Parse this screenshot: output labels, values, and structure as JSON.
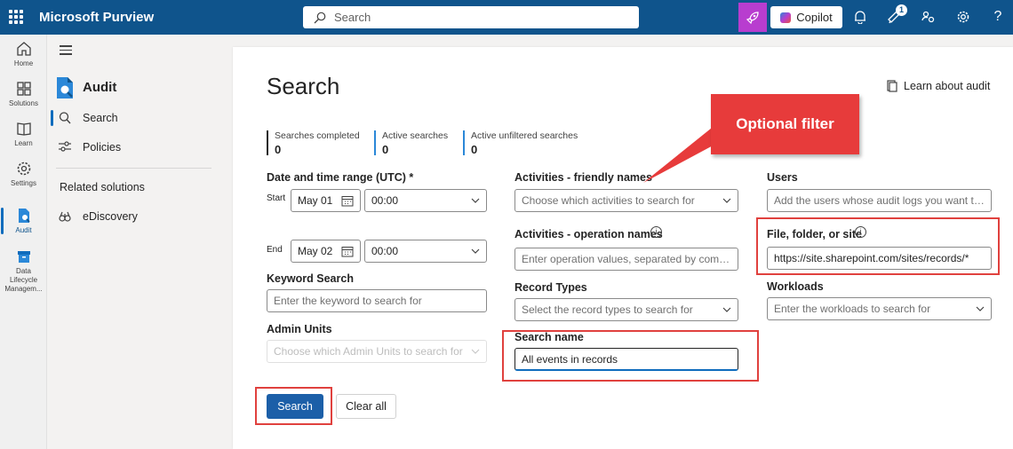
{
  "app": {
    "title": "Microsoft Purview"
  },
  "topbar": {
    "search_placeholder": "Search",
    "copilot_label": "Copilot",
    "notification_badge": "1",
    "help_label": "?"
  },
  "rail": {
    "items": [
      {
        "label": "Home",
        "icon": "home-icon"
      },
      {
        "label": "Solutions",
        "icon": "solutions-icon"
      },
      {
        "label": "Learn",
        "icon": "learn-icon"
      },
      {
        "label": "Settings",
        "icon": "gear-icon"
      },
      {
        "label": "Audit",
        "icon": "audit-icon"
      },
      {
        "label": "Data Lifecycle Managem...",
        "icon": "archive-icon"
      }
    ]
  },
  "nav": {
    "title": "Audit",
    "items": [
      {
        "label": "Search",
        "icon": "search-icon"
      },
      {
        "label": "Policies",
        "icon": "sliders-icon"
      }
    ],
    "related_heading": "Related solutions",
    "related": [
      {
        "label": "eDiscovery",
        "icon": "ediscovery-icon"
      }
    ]
  },
  "main": {
    "title": "Search",
    "learn_link": "Learn about audit",
    "stats": [
      {
        "label": "Searches completed",
        "value": "0"
      },
      {
        "label": "Active searches",
        "value": "0"
      },
      {
        "label": "Active unfiltered searches",
        "value": "0"
      }
    ],
    "date_range": {
      "label": "Date and time range (UTC) *",
      "start_label": "Start",
      "start_date": "May 01",
      "start_time": "00:00",
      "end_label": "End",
      "end_date": "May 02",
      "end_time": "00:00"
    },
    "keyword": {
      "label": "Keyword Search",
      "placeholder": "Enter the keyword to search for"
    },
    "admin_units": {
      "label": "Admin Units",
      "placeholder": "Choose which Admin Units to search for"
    },
    "activities_friendly": {
      "label": "Activities - friendly names",
      "placeholder": "Choose which activities to search for"
    },
    "activities_operation": {
      "label": "Activities - operation names",
      "placeholder": "Enter operation values, separated by commas"
    },
    "record_types": {
      "label": "Record Types",
      "placeholder": "Select the record types to search for"
    },
    "search_name": {
      "label": "Search name",
      "value": "All events in records"
    },
    "users": {
      "label": "Users",
      "placeholder": "Add the users whose audit logs you want to se..."
    },
    "file_folder": {
      "label": "File, folder, or site",
      "value": "https://site.sharepoint.com/sites/records/*"
    },
    "workloads": {
      "label": "Workloads",
      "placeholder": "Enter the workloads to search for"
    },
    "search_button": "Search",
    "clear_button": "Clear all"
  },
  "annotation": {
    "callout_text": "Optional filter",
    "color": "#e73b3b"
  },
  "colors": {
    "brand": "#0f548c",
    "primary_button": "#1c5fa8",
    "copilot_accent": "#b83dcf"
  }
}
